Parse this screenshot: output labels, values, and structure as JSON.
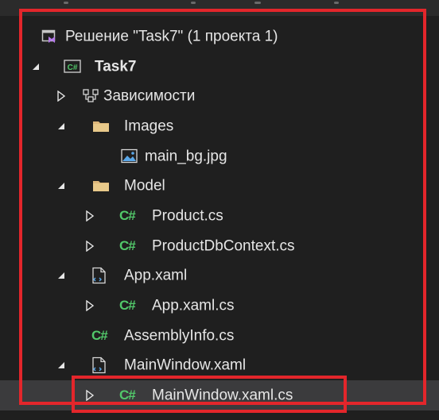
{
  "solution": {
    "label": "Решение \"Task7\"  (1 проекта 1)",
    "icon": "solution-icon"
  },
  "tree": [
    {
      "label": "Task7",
      "icon": "csproj-icon",
      "expander": "expanded",
      "bold": true
    },
    {
      "label": "Зависимости",
      "icon": "dependencies-icon",
      "expander": "collapsed"
    },
    {
      "label": "Images",
      "icon": "folder-icon",
      "expander": "expanded"
    },
    {
      "label": "main_bg.jpg",
      "icon": "image-file-icon",
      "expander": "none"
    },
    {
      "label": "Model",
      "icon": "folder-icon",
      "expander": "expanded"
    },
    {
      "label": "Product.cs",
      "icon": "csharp-file-icon",
      "expander": "collapsed",
      "icon_text": "C#"
    },
    {
      "label": "ProductDbContext.cs",
      "icon": "csharp-file-icon",
      "expander": "collapsed",
      "icon_text": "C#"
    },
    {
      "label": "App.xaml",
      "icon": "xaml-file-icon",
      "expander": "expanded"
    },
    {
      "label": "App.xaml.cs",
      "icon": "csharp-file-icon",
      "expander": "collapsed",
      "icon_text": "C#"
    },
    {
      "label": "AssemblyInfo.cs",
      "icon": "csharp-file-icon",
      "expander": "none",
      "icon_text": "C#"
    },
    {
      "label": "MainWindow.xaml",
      "icon": "xaml-file-icon",
      "expander": "expanded"
    },
    {
      "label": "MainWindow.xaml.cs",
      "icon": "csharp-file-icon",
      "expander": "collapsed",
      "icon_text": "C#",
      "selected": true
    }
  ],
  "colors": {
    "background": "#1f1f1f",
    "text": "#e6e6e6",
    "highlight": "#e3262b",
    "csharp": "#52c86a",
    "selected_row": "#3b3b3d",
    "folder": "#dcb67a"
  }
}
